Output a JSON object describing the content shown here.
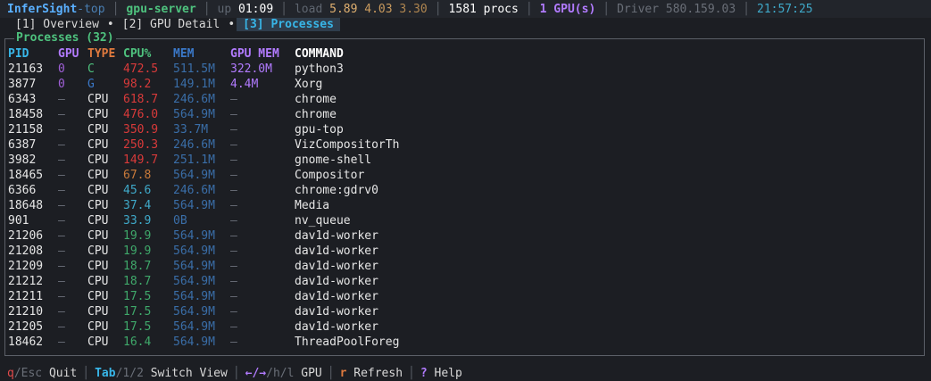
{
  "topbar": {
    "brand_a": "InferSight",
    "brand_b": "-top",
    "host": "gpu-server",
    "uptime_label": "up",
    "uptime_value": "01:09",
    "load_label": "load",
    "load1": "5.89",
    "load2": "4.03",
    "load3": "3.30",
    "procs": "1581 procs",
    "gpus": "1 GPU(s)",
    "driver": "Driver 580.159.03",
    "clock": "21:57:25"
  },
  "tabs": [
    {
      "label": "[1] Overview"
    },
    {
      "label": "[2] GPU Detail"
    },
    {
      "label": "[3] Processes"
    }
  ],
  "panel": {
    "title": "Processes (32)"
  },
  "columns": {
    "pid": "PID",
    "gpu": "GPU",
    "type": "TYPE",
    "cpu": "CPU%",
    "mem": "MEM",
    "gpu_mem": "GPU MEM",
    "command": "COMMAND"
  },
  "rows": [
    {
      "pid": "21163",
      "gpu": "0",
      "type": "C",
      "cpu": "472.5",
      "mem": "511.5M",
      "gpu_mem": "322.0M",
      "command": "python3"
    },
    {
      "pid": "3877",
      "gpu": "0",
      "type": "G",
      "cpu": "98.2",
      "mem": "149.1M",
      "gpu_mem": "4.4M",
      "command": "Xorg"
    },
    {
      "pid": "6343",
      "gpu": "—",
      "type": "CPU",
      "cpu": "618.7",
      "mem": "246.6M",
      "gpu_mem": "—",
      "command": "chrome"
    },
    {
      "pid": "18458",
      "gpu": "—",
      "type": "CPU",
      "cpu": "476.0",
      "mem": "564.9M",
      "gpu_mem": "—",
      "command": "chrome"
    },
    {
      "pid": "21158",
      "gpu": "—",
      "type": "CPU",
      "cpu": "350.9",
      "mem": "33.7M",
      "gpu_mem": "—",
      "command": "gpu-top"
    },
    {
      "pid": "6387",
      "gpu": "—",
      "type": "CPU",
      "cpu": "250.3",
      "mem": "246.6M",
      "gpu_mem": "—",
      "command": "VizCompositorTh"
    },
    {
      "pid": "3982",
      "gpu": "—",
      "type": "CPU",
      "cpu": "149.7",
      "mem": "251.1M",
      "gpu_mem": "—",
      "command": "gnome-shell"
    },
    {
      "pid": "18465",
      "gpu": "—",
      "type": "CPU",
      "cpu": "67.8",
      "mem": "564.9M",
      "gpu_mem": "—",
      "command": "Compositor"
    },
    {
      "pid": "6366",
      "gpu": "—",
      "type": "CPU",
      "cpu": "45.6",
      "mem": "246.6M",
      "gpu_mem": "—",
      "command": "chrome:gdrv0"
    },
    {
      "pid": "18648",
      "gpu": "—",
      "type": "CPU",
      "cpu": "37.4",
      "mem": "564.9M",
      "gpu_mem": "—",
      "command": "Media"
    },
    {
      "pid": "901",
      "gpu": "—",
      "type": "CPU",
      "cpu": "33.9",
      "mem": "0B",
      "gpu_mem": "—",
      "command": "nv_queue"
    },
    {
      "pid": "21206",
      "gpu": "—",
      "type": "CPU",
      "cpu": "19.9",
      "mem": "564.9M",
      "gpu_mem": "—",
      "command": "dav1d-worker"
    },
    {
      "pid": "21208",
      "gpu": "—",
      "type": "CPU",
      "cpu": "19.9",
      "mem": "564.9M",
      "gpu_mem": "—",
      "command": "dav1d-worker"
    },
    {
      "pid": "21209",
      "gpu": "—",
      "type": "CPU",
      "cpu": "18.7",
      "mem": "564.9M",
      "gpu_mem": "—",
      "command": "dav1d-worker"
    },
    {
      "pid": "21212",
      "gpu": "—",
      "type": "CPU",
      "cpu": "18.7",
      "mem": "564.9M",
      "gpu_mem": "—",
      "command": "dav1d-worker"
    },
    {
      "pid": "21211",
      "gpu": "—",
      "type": "CPU",
      "cpu": "17.5",
      "mem": "564.9M",
      "gpu_mem": "—",
      "command": "dav1d-worker"
    },
    {
      "pid": "21210",
      "gpu": "—",
      "type": "CPU",
      "cpu": "17.5",
      "mem": "564.9M",
      "gpu_mem": "—",
      "command": "dav1d-worker"
    },
    {
      "pid": "21205",
      "gpu": "—",
      "type": "CPU",
      "cpu": "17.5",
      "mem": "564.9M",
      "gpu_mem": "—",
      "command": "dav1d-worker"
    },
    {
      "pid": "18462",
      "gpu": "—",
      "type": "CPU",
      "cpu": "16.4",
      "mem": "564.9M",
      "gpu_mem": "—",
      "command": "ThreadPoolForeg"
    }
  ],
  "footer": {
    "quit_key_a": "q",
    "quit_key_b": "/Esc",
    "quit_label": " Quit",
    "tab_key_a": "Tab",
    "tab_key_b": "/1/2",
    "tab_label": " Switch View",
    "gpu_key_a": "←/→",
    "gpu_key_b": "/h/l",
    "gpu_label": " GPU",
    "refresh_key": "r",
    "refresh_label": " Refresh",
    "help_key": "?",
    "help_label": " Help"
  },
  "colors": {
    "background": "#1c1e23",
    "accent": "#38b6e8",
    "host": "#4ec27e",
    "gpu": "#b27bff",
    "cpu_high": "#d83a3a"
  }
}
